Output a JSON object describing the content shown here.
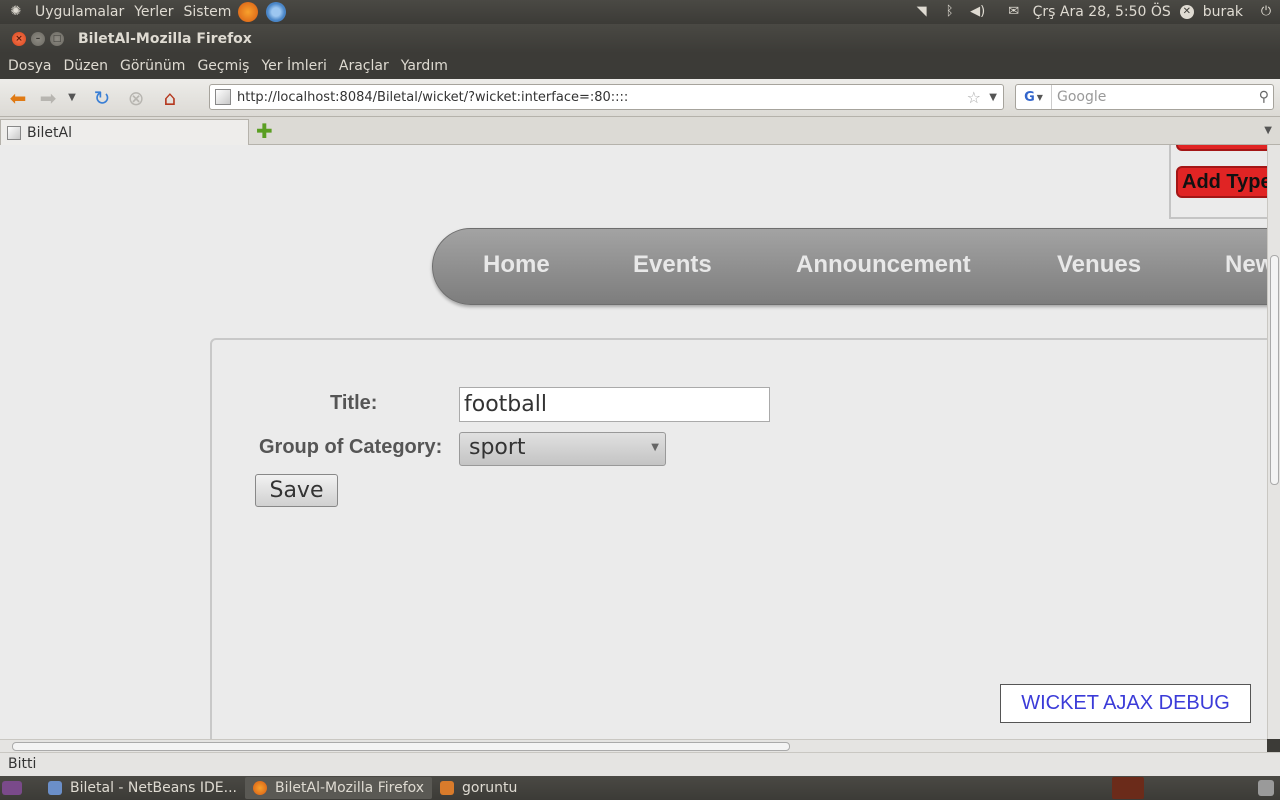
{
  "top_panel": {
    "apps": "Uygulamalar",
    "places": "Yerler",
    "system": "Sistem",
    "datetime": "Çrş Ara 28,  5:50 ÖS",
    "user": "burak"
  },
  "window": {
    "title": "BiletAl-Mozilla Firefox"
  },
  "menu": [
    "Dosya",
    "Düzen",
    "Görünüm",
    "Geçmiş",
    "Yer İmleri",
    "Araçlar",
    "Yardım"
  ],
  "navigation": {
    "url": "http://localhost:8084/Biletal/wicket/?wicket:interface=:80::::",
    "search_placeholder": "Google"
  },
  "tab": {
    "title": "BiletAl"
  },
  "page": {
    "add_type_button": "Add Type",
    "nav_items": [
      "Home",
      "Events",
      "Announcement",
      "Venues",
      "News"
    ],
    "form": {
      "title_label": "Title:",
      "title_value": "football",
      "group_label": "Group of Category:",
      "group_value": "sport",
      "save_label": "Save"
    },
    "debug_label": "WICKET AJAX DEBUG"
  },
  "status_text": "Bitti",
  "taskbar": [
    "Biletal - NetBeans IDE...",
    "BiletAl-Mozilla Firefox",
    "goruntu"
  ]
}
